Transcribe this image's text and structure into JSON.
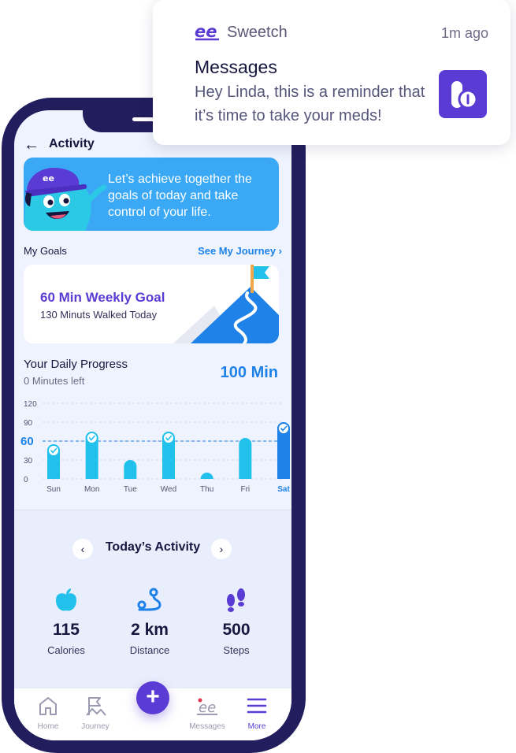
{
  "notification": {
    "app_name": "Sweetch",
    "time": "1m ago",
    "title": "Messages",
    "body": "Hey Linda, this is a reminder that it’s time to take your meds!"
  },
  "header": {
    "title": "Activity"
  },
  "banner": {
    "text": "Let’s achieve together the goals of today and take control of your life."
  },
  "goals": {
    "section_label": "My Goals",
    "link_label": "See My Journey ›",
    "goal_title": "60 Min Weekly Goal",
    "goal_sub": "130 Minuts Walked Today"
  },
  "progress": {
    "title": "Your Daily Progress",
    "subtitle": "0 Minutes left",
    "total": "100 Min"
  },
  "chart_data": {
    "type": "bar",
    "categories": [
      "Sun",
      "Mon",
      "Tue",
      "Wed",
      "Thu",
      "Fri",
      "Sat"
    ],
    "values": [
      55,
      75,
      30,
      75,
      10,
      65,
      90
    ],
    "completed": [
      true,
      true,
      false,
      true,
      false,
      false,
      true
    ],
    "highlighted_category": "Sat",
    "y_ticks": [
      0,
      30,
      60,
      90,
      120
    ],
    "target": 60,
    "ylim": [
      0,
      120
    ],
    "grid": true,
    "colors": {
      "bar": "#21c1ec",
      "highlight": "#1f82e8",
      "target": "#1f82e8"
    }
  },
  "today": {
    "title": "Today’s Activity",
    "prev": "‹",
    "next": "›",
    "stats": [
      {
        "value": "115",
        "label": "Calories",
        "icon": "apple-icon"
      },
      {
        "value": "2 km",
        "label": "Distance",
        "icon": "route-icon"
      },
      {
        "value": "500",
        "label": "Steps",
        "icon": "footsteps-icon"
      }
    ]
  },
  "tabs": [
    {
      "label": "Home",
      "icon": "home-icon"
    },
    {
      "label": "Journey",
      "icon": "journey-icon"
    },
    {
      "label": "Messages",
      "icon": "messages-icon"
    },
    {
      "label": "More",
      "icon": "menu-icon"
    }
  ],
  "fab": {
    "label": "+"
  },
  "colors": {
    "primary": "#5a3bd3",
    "accent": "#1f82e8",
    "bar": "#21c1ec",
    "phone": "#221d5c"
  }
}
